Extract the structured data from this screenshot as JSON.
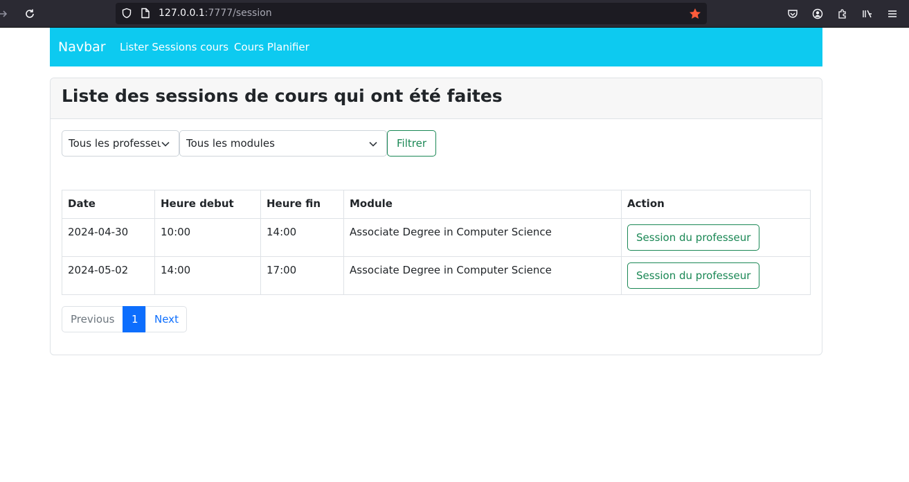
{
  "browser": {
    "url_host": "127.0.0.1",
    "url_rest": ":7777/session"
  },
  "navbar": {
    "brand": "Navbar",
    "links": [
      "Lister Sessions cours",
      "Cours Planifier"
    ],
    "color": "#0dcaf0"
  },
  "card": {
    "title": "Liste des sessions de cours qui ont été faites"
  },
  "filters": {
    "professor_select": "Tous les professeurs",
    "module_select": "Tous les modules",
    "filter_button": "Filtrer"
  },
  "table": {
    "headers": [
      "Date",
      "Heure debut",
      "Heure fin",
      "Module",
      "Action"
    ],
    "rows": [
      {
        "date": "2024-04-30",
        "start": "10:00",
        "end": "14:00",
        "module": "Associate Degree in Computer Science",
        "action": "Session du professeur"
      },
      {
        "date": "2024-05-02",
        "start": "14:00",
        "end": "17:00",
        "module": "Associate Degree in Computer Science",
        "action": "Session du professeur"
      }
    ]
  },
  "pagination": {
    "previous": "Previous",
    "current": "1",
    "next": "Next"
  }
}
